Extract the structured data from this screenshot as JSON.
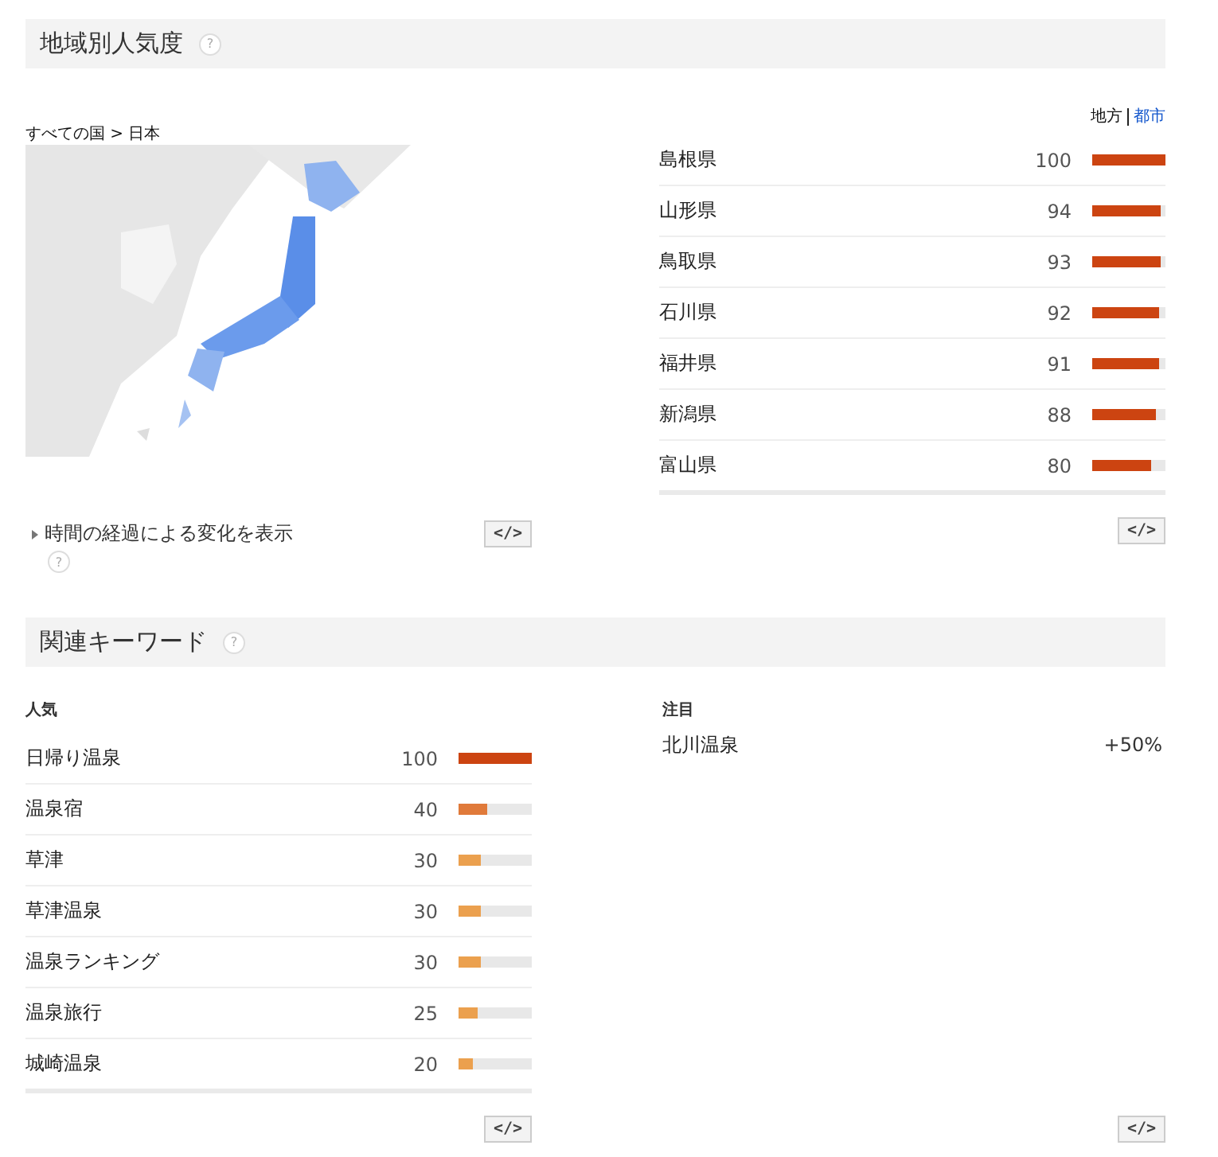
{
  "regional": {
    "title": "地域別人気度",
    "help": "?",
    "breadcrumb": "すべての国 > 日本",
    "time_toggle": {
      "label": "時間の経過による変化を表示",
      "expanded": false,
      "help": "?"
    },
    "embed_left": "</>",
    "embed_right": "</>",
    "views": [
      {
        "label": "地方",
        "selected": true
      },
      {
        "label": "都市",
        "selected": false
      }
    ],
    "rows": [
      {
        "name": "島根県",
        "value": "100",
        "level": 1.0
      },
      {
        "name": "山形県",
        "value": "94",
        "level": 0.94
      },
      {
        "name": "鳥取県",
        "value": "93",
        "level": 0.93
      },
      {
        "name": "石川県",
        "value": "92",
        "level": 0.92
      },
      {
        "name": "福井県",
        "value": "91",
        "level": 0.91
      },
      {
        "name": "新潟県",
        "value": "88",
        "level": 0.88
      },
      {
        "name": "富山県",
        "value": "80",
        "level": 0.8
      }
    ]
  },
  "keywords": {
    "title": "関連キーワード",
    "help": "?",
    "top_heading": "人気",
    "rising_heading": "注目",
    "embed_left": "</>",
    "embed_right": "</>",
    "top": [
      {
        "name": "日帰り温泉",
        "value": "100",
        "level": 1.0,
        "color": "#cc4411"
      },
      {
        "name": "温泉宿",
        "value": "40",
        "level": 0.4,
        "color": "#e07a3a"
      },
      {
        "name": "草津",
        "value": "30",
        "level": 0.3,
        "color": "#eba04e"
      },
      {
        "name": "草津温泉",
        "value": "30",
        "level": 0.3,
        "color": "#eba04e"
      },
      {
        "name": "温泉ランキング",
        "value": "30",
        "level": 0.3,
        "color": "#eba04e"
      },
      {
        "name": "温泉旅行",
        "value": "25",
        "level": 0.25,
        "color": "#eba04e"
      },
      {
        "name": "城崎温泉",
        "value": "20",
        "level": 0.2,
        "color": "#eba04e"
      }
    ],
    "rising": [
      {
        "name": "北川温泉",
        "value": "+50%"
      }
    ]
  }
}
